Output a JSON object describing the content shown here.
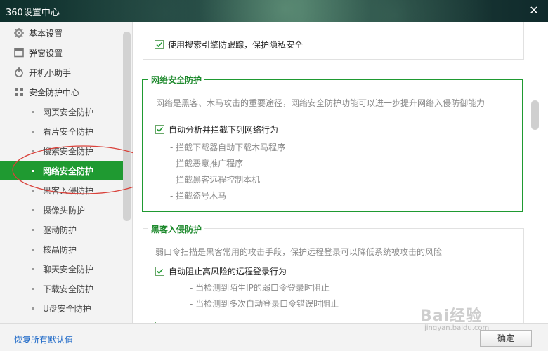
{
  "window": {
    "title": "360设置中心",
    "close_glyph": "✕"
  },
  "sidebar": {
    "groups": [
      {
        "label": "基本设置",
        "icon": "gear-icon"
      },
      {
        "label": "弹窗设置",
        "icon": "window-icon"
      },
      {
        "label": "开机小助手",
        "icon": "power-icon"
      },
      {
        "label": "安全防护中心",
        "icon": "grid-icon"
      }
    ],
    "items": [
      "网页安全防护",
      "看片安全防护",
      "搜索安全防护",
      "网络安全防护",
      "黑客入侵防护",
      "摄像头防护",
      "驱动防护",
      "核晶防护",
      "聊天安全防护",
      "下载安全防护",
      "U盘安全防护"
    ],
    "active_item": "网络安全防护"
  },
  "main": {
    "search_tracking_label": "使用搜索引擎防跟踪，保护隐私安全",
    "network": {
      "title": "网络安全防护",
      "description": "网络是黑客、木马攻击的重要途径，网络安全防护功能可以进一步提升网络入侵防御能力",
      "checkbox_label": "自动分析并拦截下列网络行为",
      "items": [
        "- 拦截下载器自动下载木马程序",
        "- 拦截恶意推广程序",
        "- 拦截黑客远程控制本机",
        "- 拦截盗号木马"
      ]
    },
    "hacker": {
      "title": "黑客入侵防护",
      "description": "弱口令扫描是黑客常用的攻击手段，保护远程登录可以降低系统被攻击的风险",
      "checkbox_label": "自动阻止高风险的远程登录行为",
      "items": [
        "- 当检测到陌生IP的弱口令登录时阻止",
        "- 当检测到多次自动登录口令错误时阻止"
      ]
    }
  },
  "footer": {
    "restore_label": "恢复所有默认值",
    "ok_label": "确定"
  },
  "watermark": {
    "brand": "Bai经验",
    "url": "jingyan.baidu.com"
  },
  "colors": {
    "accent_green": "#1f9a31",
    "link_blue": "#1b67c7",
    "annotation_red": "#d9413a"
  }
}
